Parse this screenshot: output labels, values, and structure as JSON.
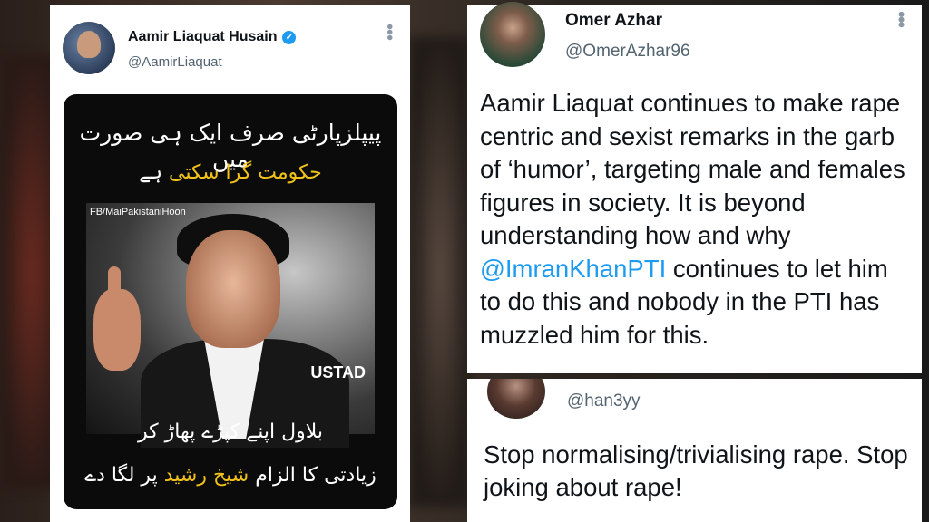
{
  "left_tweet": {
    "name": "Aamir Liaquat Husain",
    "handle": "@AamirLiaquat",
    "meme": {
      "top_line_1": "پیپلزپارٹی صرف ایک ہی صورت میں",
      "top_line_2_highlight": "حکومت گرا سکتی",
      "top_line_2_rest": "ہے",
      "watermark": "FB/MaiPakistaniHoon",
      "caption": "USTAD",
      "bottom_line_1": "بلاول اپنے کپڑے پھاڑ کر",
      "bottom_line_2_a": "زیادتی کا الزام",
      "bottom_line_2_highlight": "شیخ رشید",
      "bottom_line_2_b": "پر لگا دے"
    }
  },
  "right_top_tweet": {
    "name": "Omer Azhar",
    "handle": "@OmerAzhar96",
    "text_before_mention": "Aamir Liaquat continues to make rape centric and sexist remarks in the garb of ‘humor’, targeting male and females figures in society. It is beyond understanding how and why ",
    "mention": "@ImranKhanPTI",
    "text_after_mention": " continues to let him to do this and nobody in the PTI has muzzled him for this."
  },
  "right_bottom_tweet": {
    "handle": "@han3yy",
    "text": "Stop normalising/trivialising rape. Stop joking about rape!"
  },
  "colors": {
    "mention": "#1d9bf0",
    "verified": "#1d9bf0",
    "meme_highlight": "#f2c21a"
  }
}
